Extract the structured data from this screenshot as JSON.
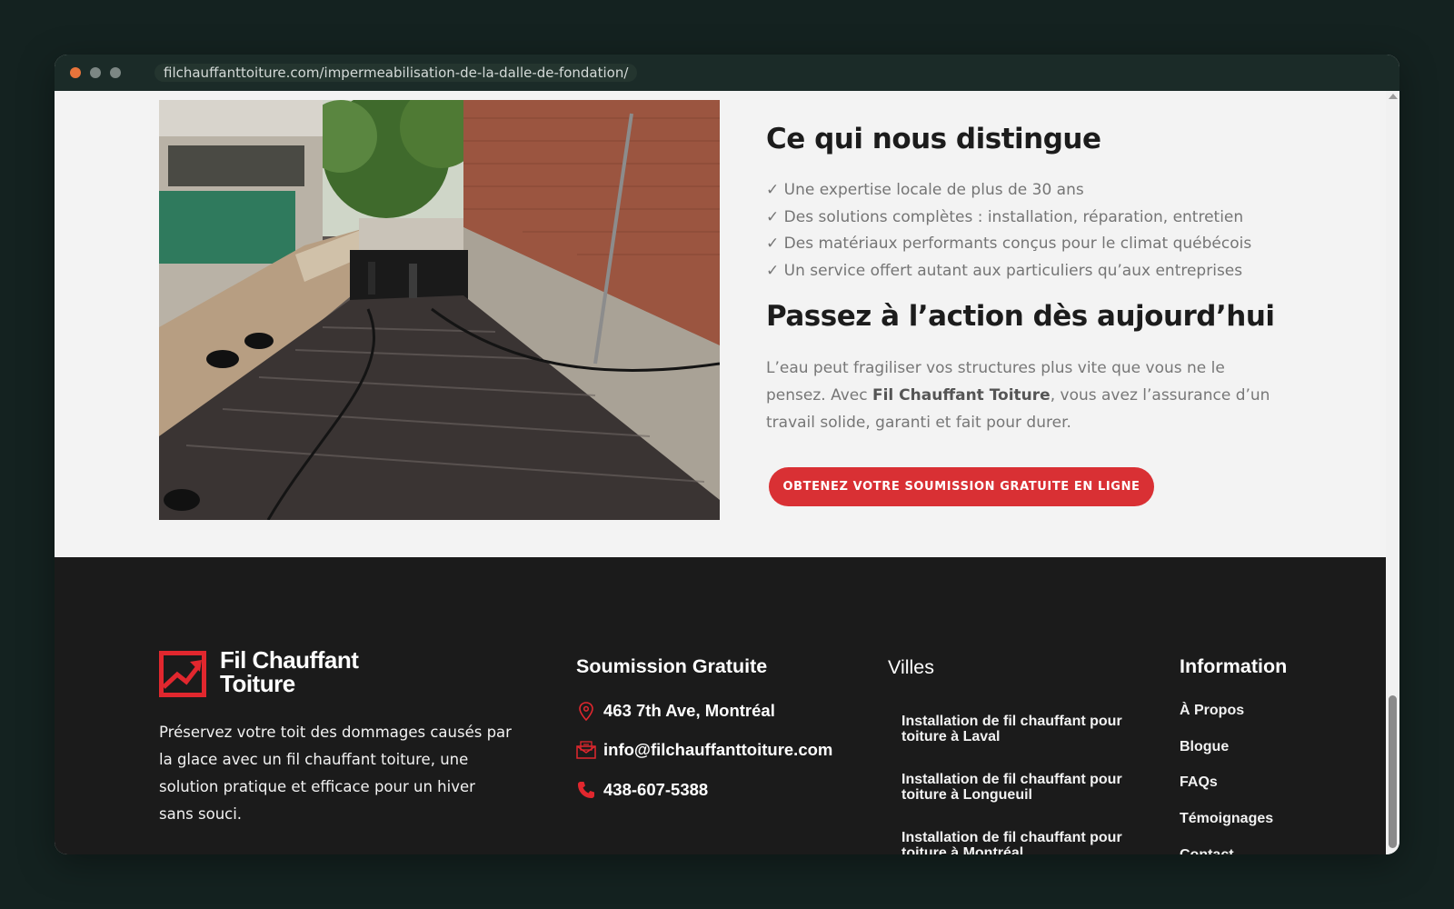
{
  "browser": {
    "url": "filchauffanttoiture.com/impermeabilisation-de-la-dalle-de-fondation/"
  },
  "main": {
    "heading_distinctions": "Ce qui nous distingue",
    "features": [
      "✓ Une expertise locale de plus de 30 ans",
      "✓ Des solutions complètes : installation, réparation, entretien",
      "✓ Des matériaux performants conçus pour le climat québécois",
      "✓ Un service offert autant aux particuliers qu’aux entreprises"
    ],
    "heading_action": "Passez à l’action dès aujourd’hui",
    "cta_text_before": "L’eau peut fragiliser vos structures plus vite que vous ne le pensez. Avec ",
    "cta_text_brand": "Fil Chauffant Toiture",
    "cta_text_after": ", vous avez l’assurance d’un travail solide, garanti et fait pour durer.",
    "cta_button": "OBTENEZ VOTRE SOUMISSION GRATUITE EN LIGNE"
  },
  "footer": {
    "logo_line1": "Fil Chauffant",
    "logo_line2": "Toiture",
    "tagline": "Préservez votre toit des dommages causés par la glace avec un fil chauffant toiture, une solution pratique et efficace pour un hiver sans souci.",
    "soumission": {
      "title": "Soumission Gratuite",
      "address": "463 7th Ave, Montréal",
      "email": "info@filchauffanttoiture.com",
      "phone": "438-607-5388"
    },
    "villes": {
      "title": "Villes",
      "links": [
        "Installation de fil chauffant pour toiture à Laval",
        "Installation de fil chauffant pour toiture à Longueuil",
        "Installation de fil chauffant pour toiture à Montréal"
      ]
    },
    "information": {
      "title": "Information",
      "links": [
        "À Propos",
        "Blogue",
        "FAQs",
        "Témoignages",
        "Contact"
      ]
    }
  },
  "colors": {
    "accent": "#d93034",
    "footer_bg": "#1b1b1b",
    "page_bg": "#f3f3f3"
  }
}
